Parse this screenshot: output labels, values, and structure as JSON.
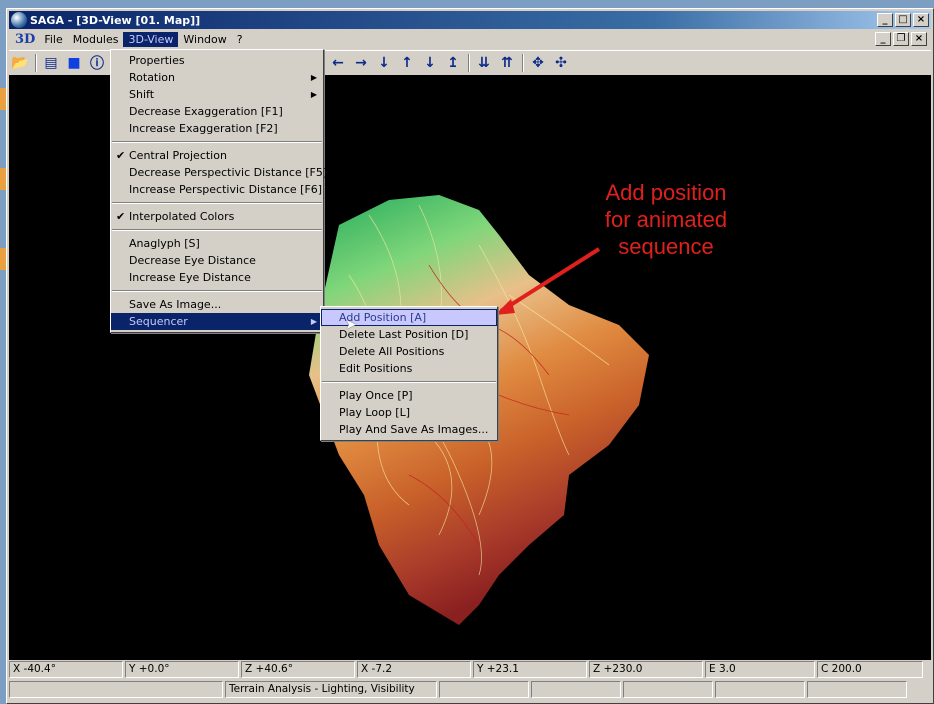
{
  "window": {
    "title": "SAGA - [3D-View [01. Map]]"
  },
  "menubar": {
    "logo": "3D",
    "items": [
      "File",
      "Modules",
      "3D-View",
      "Window",
      "?"
    ],
    "active_index": 2
  },
  "menu_3dview": {
    "groups": [
      [
        {
          "label": "Properties",
          "submenu": false,
          "checked": false
        },
        {
          "label": "Rotation",
          "submenu": true,
          "checked": false
        },
        {
          "label": "Shift",
          "submenu": true,
          "checked": false
        },
        {
          "label": "Decrease Exaggeration [F1]",
          "submenu": false,
          "checked": false
        },
        {
          "label": "Increase Exaggeration [F2]",
          "submenu": false,
          "checked": false
        }
      ],
      [
        {
          "label": "Central Projection",
          "submenu": false,
          "checked": true
        },
        {
          "label": "Decrease Perspectivic Distance [F5]",
          "submenu": false,
          "checked": false
        },
        {
          "label": "Increase Perspectivic Distance [F6]",
          "submenu": false,
          "checked": false
        }
      ],
      [
        {
          "label": "Interpolated Colors",
          "submenu": false,
          "checked": true
        }
      ],
      [
        {
          "label": "Anaglyph [S]",
          "submenu": false,
          "checked": false
        },
        {
          "label": "Decrease Eye Distance",
          "submenu": false,
          "checked": false
        },
        {
          "label": "Increase Eye Distance",
          "submenu": false,
          "checked": false
        }
      ],
      [
        {
          "label": "Save As Image...",
          "submenu": false,
          "checked": false
        },
        {
          "label": "Sequencer",
          "submenu": true,
          "checked": false,
          "highlighted": true
        }
      ]
    ]
  },
  "menu_sequencer": {
    "groups": [
      [
        {
          "label": "Add Position [A]",
          "hovered": true
        },
        {
          "label": "Delete Last Position [D]"
        },
        {
          "label": "Delete All Positions"
        },
        {
          "label": "Edit Positions"
        }
      ],
      [
        {
          "label": "Play Once [P]"
        },
        {
          "label": "Play Loop [L]"
        },
        {
          "label": "Play And Save As Images..."
        }
      ]
    ]
  },
  "annotation": {
    "line1": "Add position",
    "line2": "for animated",
    "line3": "sequence",
    "color": "#e0201c"
  },
  "status": {
    "row1": [
      "X -40.4°",
      "Y +0.0°",
      "Z +40.6°",
      "X -7.2",
      "Y +23.1",
      "Z +230.0",
      "E 3.0",
      "C 200.0"
    ],
    "row2": [
      "",
      "Terrain Analysis - Lighting, Visibility",
      "",
      "",
      "",
      "",
      ""
    ]
  },
  "toolbar_icons": [
    "open-folder-icon",
    "list-icon",
    "blue-square-icon",
    "info-icon",
    "arrow-left-icon",
    "arrow-right-icon",
    "arrow-down-icon",
    "arrow-up-icon",
    "arrow-down-icon",
    "arrow-up-bar-icon",
    "scale-down-icon",
    "scale-up-icon",
    "move-in-icon",
    "move-out-icon"
  ]
}
